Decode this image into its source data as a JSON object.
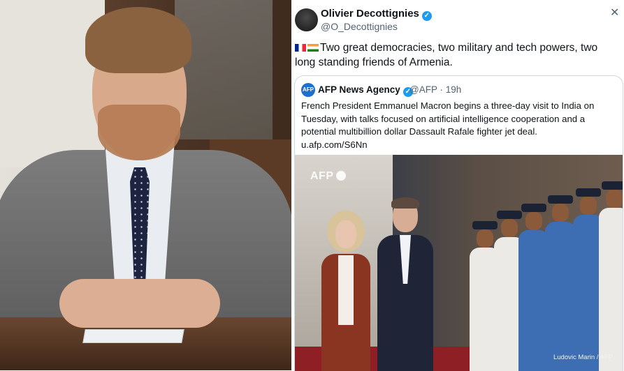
{
  "tweet": {
    "author_name": "Olivier Decottignies",
    "author_handle": "@O_Decottignies",
    "verified_mark": "✓",
    "close_glyph": "✕",
    "body": "Two great democracies, two military and tech powers, two long standing friends of Armenia."
  },
  "quoted": {
    "author_name": "AFP News Agency",
    "avatar_text": "AFP",
    "verified_mark": "✓",
    "meta": "@AFP · 19h",
    "text_line1": "French President Emmanuel Macron begins a three-day visit to India on",
    "text_line2": "Tuesday, with talks focused on artificial intelligence cooperation and a",
    "text_line3": "potential multibillion dollar Dassault Rafale fighter jet deal.",
    "link": "u.afp.com/S6Nn",
    "photo_watermark": "AFP",
    "photo_credit": "Ludovic Marin / AFP"
  },
  "icons": {
    "flag_fr": "flag-france-icon",
    "flag_in": "flag-india-icon",
    "verified": "verified-badge-icon"
  },
  "colors": {
    "verified_blue": "#1d9bf0",
    "text_primary": "#0f1419",
    "text_secondary": "#536471",
    "border": "#cfd9de"
  }
}
